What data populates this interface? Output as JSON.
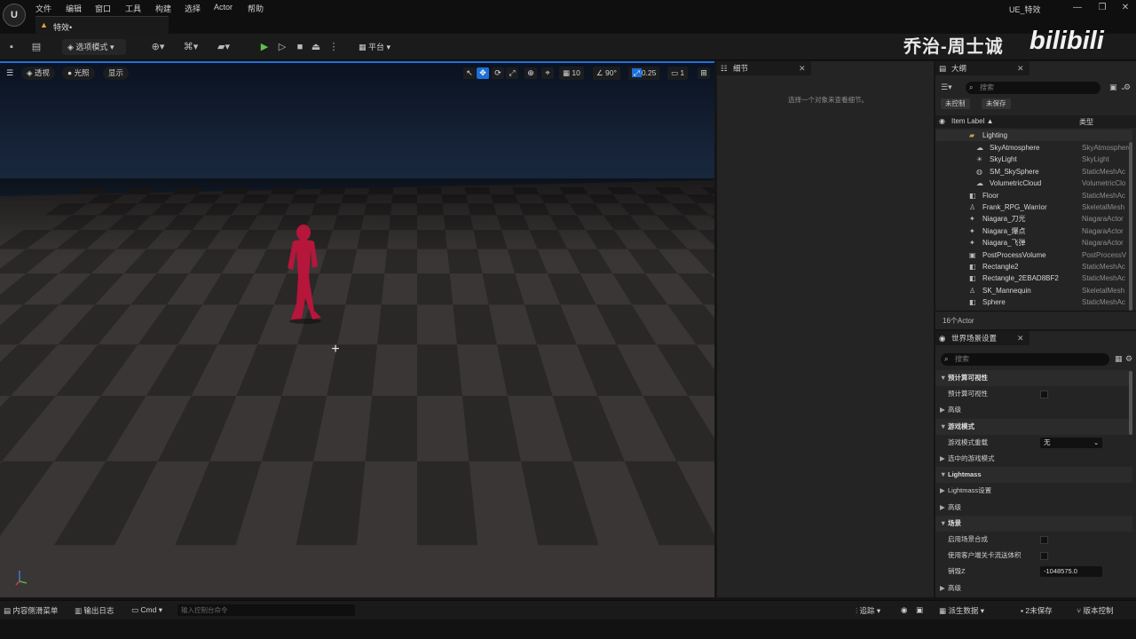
{
  "menu": [
    "文件",
    "编辑",
    "窗口",
    "工具",
    "构建",
    "选择",
    "Actor",
    "帮助"
  ],
  "app": {
    "logo": "U",
    "title": "UE_特效",
    "level_tab": "特效•"
  },
  "window_controls": [
    "—",
    "❐",
    "✕"
  ],
  "toolbar": {
    "mode_label": "选项模式",
    "platform_label": "平台"
  },
  "watermark": {
    "author": "乔治-周士诚",
    "site": "bilibili"
  },
  "viewport": {
    "perspective": "透视",
    "lit": "光照",
    "show": "显示",
    "grid_snap": "10",
    "rot_snap": "90°",
    "scale_snap": "0.25",
    "cam_speed": "1"
  },
  "details": {
    "tab": "细节",
    "empty_message": "选择一个对象来查看细节。"
  },
  "outliner": {
    "tab": "大纲",
    "search_placeholder": "搜索",
    "tabs": [
      "未控制",
      "未保存"
    ],
    "col_label": "Item Label ▲",
    "col_type": "类型",
    "folder": "Lighting",
    "rows": [
      {
        "name": "SkyAtmosphere",
        "type": "SkyAtmosphere",
        "icon": "☁",
        "indent": 2
      },
      {
        "name": "SkyLight",
        "type": "SkyLight",
        "icon": "☀",
        "indent": 2
      },
      {
        "name": "SM_SkySphere",
        "type": "StaticMeshAc",
        "icon": "◍",
        "indent": 2
      },
      {
        "name": "VolumetricCloud",
        "type": "VolumetricClo",
        "icon": "☁",
        "indent": 2
      },
      {
        "name": "Floor",
        "type": "StaticMeshAc",
        "icon": "◧",
        "indent": 1
      },
      {
        "name": "Frank_RPG_Warrior",
        "type": "SkeletalMesh",
        "icon": "♙",
        "indent": 1
      },
      {
        "name": "Niagara_刀光",
        "type": "NiagaraActor",
        "icon": "✦",
        "indent": 1
      },
      {
        "name": "Niagara_爆点",
        "type": "NiagaraActor",
        "icon": "✦",
        "indent": 1
      },
      {
        "name": "Niagara_飞弹",
        "type": "NiagaraActor",
        "icon": "✦",
        "indent": 1
      },
      {
        "name": "PostProcessVolume",
        "type": "PostProcessV",
        "icon": "▣",
        "indent": 1
      },
      {
        "name": "Rectangle2",
        "type": "StaticMeshAc",
        "icon": "◧",
        "indent": 1
      },
      {
        "name": "Rectangle_2EBAD8BF2",
        "type": "StaticMeshAc",
        "icon": "◧",
        "indent": 1
      },
      {
        "name": "SK_Mannequin",
        "type": "SkeletalMesh",
        "icon": "♙",
        "indent": 1
      },
      {
        "name": "Sphere",
        "type": "StaticMeshAc",
        "icon": "◧",
        "indent": 1
      }
    ],
    "count": "16个Actor"
  },
  "world_settings": {
    "tab": "世界场景设置",
    "search_placeholder": "搜索",
    "rows": [
      {
        "kind": "cat",
        "label": "预计算可视性",
        "arrow": "▼"
      },
      {
        "kind": "check",
        "label": "预计算可视性"
      },
      {
        "kind": "sub",
        "label": "高级",
        "arrow": "▶"
      },
      {
        "kind": "cat",
        "label": "游戏模式",
        "arrow": "▼"
      },
      {
        "kind": "dropdown",
        "label": "游戏模式重载",
        "value": "无"
      },
      {
        "kind": "sub",
        "label": "选中的游戏模式",
        "arrow": "▶"
      },
      {
        "kind": "cat",
        "label": "Lightmass",
        "arrow": "▼"
      },
      {
        "kind": "sub",
        "label": "Lightmass设置",
        "arrow": "▶"
      },
      {
        "kind": "sub",
        "label": "高级",
        "arrow": "▶"
      },
      {
        "kind": "cat",
        "label": "场景",
        "arrow": "▼"
      },
      {
        "kind": "check",
        "label": "启用场景合成"
      },
      {
        "kind": "check",
        "label": "使用客户端关卡流送体积"
      },
      {
        "kind": "number",
        "label": "销毁Z",
        "value": "-1048575.0"
      },
      {
        "kind": "sub",
        "label": "高级",
        "arrow": "▶"
      }
    ]
  },
  "statusbar": {
    "content_drawer": "内容侧滑菜单",
    "output_log": "输出日志",
    "cmd": "Cmd",
    "cmd_placeholder": "输入控制台命令",
    "trace": "追踪",
    "derived_data": "派生数据",
    "unsaved": "2未保存",
    "source_control": "版本控制"
  }
}
